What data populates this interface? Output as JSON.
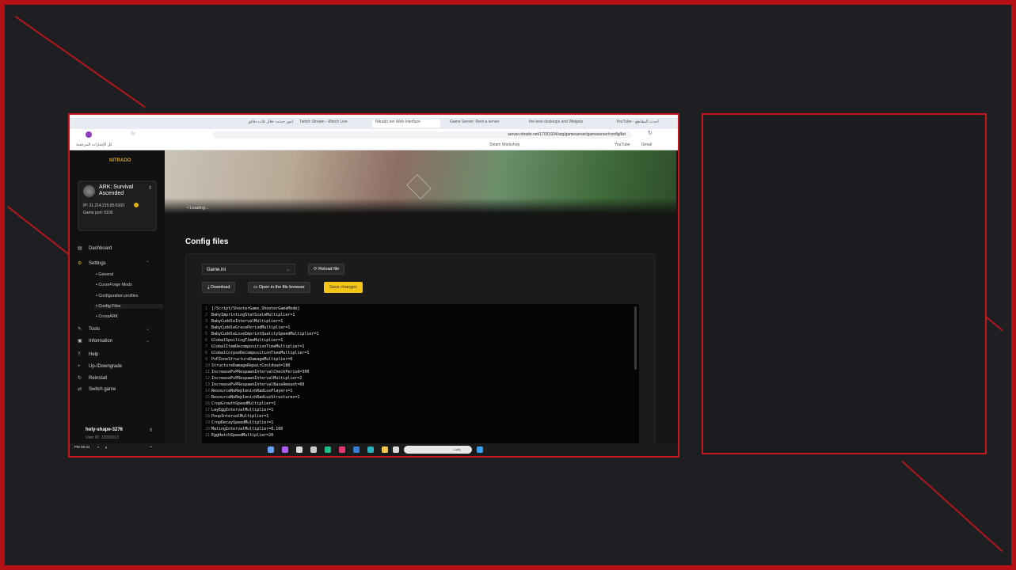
{
  "browser": {
    "tabs": [
      {
        "label": "أمور حدثت خلال ثلاث دقائق"
      },
      {
        "label": "Twitch Stream - Watch Live"
      },
      {
        "label": "Nitrado.net Web Interface",
        "active": true
      },
      {
        "label": "Game Server: Rent a server"
      },
      {
        "label": "the best desktops and Widgets"
      },
      {
        "label": "YouTube - أحدث المقاطع"
      }
    ],
    "url": "server.nitrado.net/17031934/arg/gameserver/gameserver/config/list",
    "bookmarks": [
      "كل الإشارات المرجعية",
      "Steam Workshop",
      "YouTube",
      "Gmail"
    ]
  },
  "sidebar": {
    "logo": "NITRADO",
    "server": {
      "name": "ARK: Survival Ascended",
      "ip": "IP: 31.214.215.85:5100",
      "port": "Game port: 5100"
    },
    "nav": [
      {
        "label": "Dashboard",
        "icon": "dashboard-icon"
      },
      {
        "label": "Settings",
        "icon": "gear-icon"
      },
      {
        "label": "General",
        "sub": true
      },
      {
        "label": "CurseForge Mods",
        "sub": true
      },
      {
        "label": "Configuration profiles",
        "sub": true
      },
      {
        "label": "Config Files",
        "sub": true,
        "active": true
      },
      {
        "label": "CrossARK",
        "sub": true
      },
      {
        "label": "Tools",
        "icon": "wrench-icon"
      },
      {
        "label": "Information",
        "icon": "info-icon"
      },
      {
        "label": "Help",
        "icon": "help-icon"
      },
      {
        "label": "Up-/Downgrade",
        "icon": "plus-icon"
      },
      {
        "label": "Reinstall",
        "icon": "refresh-icon"
      },
      {
        "label": "Switch game",
        "icon": "switch-icon"
      }
    ],
    "user": {
      "name": "holy-shape-3276",
      "id": "User ID: 12003013"
    }
  },
  "main": {
    "loading": "Loading...",
    "title": "Config files",
    "file_select": "Game.ini",
    "reload": "Reload file",
    "download": "Download",
    "open_browser": "Open in the file browser",
    "save": "Save changes",
    "code": [
      "[/Script/ShooterGame.ShooterGameMode]",
      "BabyImprintingStatScaleMultiplier=1",
      "BabyCuddleIntervalMultiplier=1",
      "BabyCuddleGracePeriodMultiplier=1",
      "BabyCuddleLoseImprintQualitySpeedMultiplier=1",
      "GlobalSpoilingTimeMultiplier=1",
      "GlobalItemDecompositionTimeMultiplier=1",
      "GlobalCorpseDecompositionTimeMultiplier=1",
      "PvPZoneStructureDamageMultiplier=6",
      "StructureDamageRepairCooldown=180",
      "IncreasePvPRespawnIntervalCheckPeriod=300",
      "IncreasePvPRespawnIntervalMultiplier=2",
      "IncreasePvPRespawnIntervalBaseAmount=60",
      "ResourceNoReplenishRadiusPlayers=1",
      "ResourceNoReplenishRadiusStructures=1",
      "CropGrowthSpeedMultiplier=1",
      "LayEggIntervalMultiplier=1",
      "PoopIntervalMultiplier=1",
      "CropDecaySpeedMultiplier=1",
      "MatingIntervalMultiplier=0.100",
      "EggHatchSpeedMultiplier=20"
    ]
  },
  "taskbar": {
    "clock": "PM 06:44",
    "search_placeholder": "بحث"
  }
}
